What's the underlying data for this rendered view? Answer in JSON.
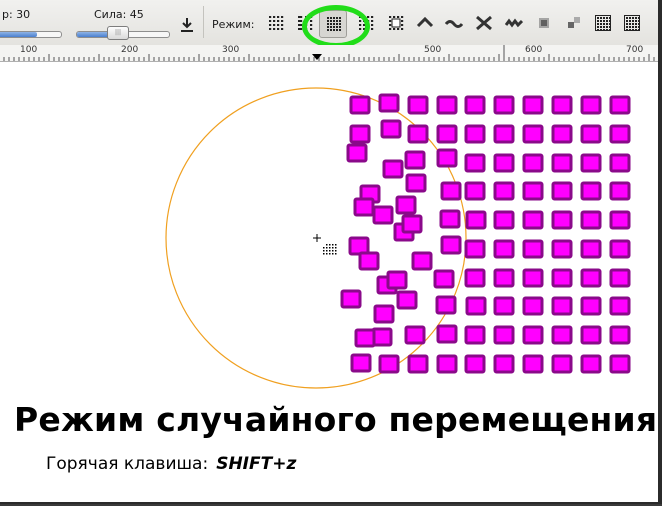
{
  "toolbar": {
    "size_text": "р: 30",
    "strength_label": "Сила: 45",
    "strength_value": 45,
    "mode_label": "Режим:",
    "modes": [
      {
        "icon": "dots-grid-icon",
        "active": false
      },
      {
        "icon": "dots-scatter-icon",
        "active": false
      },
      {
        "icon": "random-move-icon",
        "active": true
      },
      {
        "icon": "dots-shrink-icon",
        "active": false
      },
      {
        "icon": "dots-grow-icon",
        "active": false
      },
      {
        "icon": "rotate-dots-icon",
        "active": false
      },
      {
        "icon": "push-wave-icon",
        "active": false
      },
      {
        "icon": "wave-icon",
        "active": false
      },
      {
        "icon": "pinch-icon",
        "active": false
      },
      {
        "icon": "roughen-icon",
        "active": false
      },
      {
        "icon": "blur-icon",
        "active": false
      },
      {
        "icon": "blur-dots-icon",
        "active": false
      },
      {
        "icon": "grid-fill-icon",
        "active": false
      }
    ]
  },
  "ruler": {
    "labels": [
      "100",
      "200",
      "300",
      "500",
      "600",
      "700"
    ]
  },
  "colors": {
    "square_fill": "#ff00ff",
    "square_stroke": "#8a0a8a",
    "circle": "#f0a020",
    "highlight": "#21dd19"
  },
  "caption": {
    "title": "Режим случайного перемещения",
    "hotkey_label": "Горячая клавиша:",
    "hotkey": "SHIFT+z"
  }
}
